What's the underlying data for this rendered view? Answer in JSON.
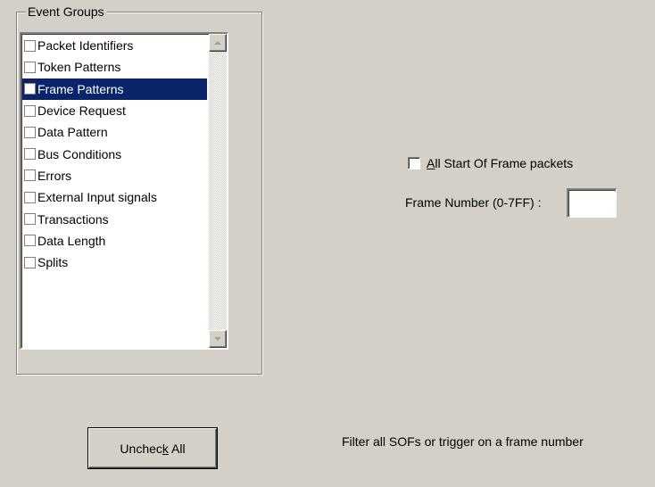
{
  "event_groups": {
    "title": "Event Groups",
    "items": [
      {
        "label": "Packet Identifiers",
        "checked": false,
        "selected": false
      },
      {
        "label": "Token Patterns",
        "checked": false,
        "selected": false
      },
      {
        "label": "Frame Patterns",
        "checked": false,
        "selected": true
      },
      {
        "label": "Device Request",
        "checked": false,
        "selected": false
      },
      {
        "label": "Data Pattern",
        "checked": false,
        "selected": false
      },
      {
        "label": "Bus Conditions",
        "checked": false,
        "selected": false
      },
      {
        "label": "Errors",
        "checked": false,
        "selected": false
      },
      {
        "label": "External Input signals",
        "checked": false,
        "selected": false
      },
      {
        "label": "Transactions",
        "checked": false,
        "selected": false
      },
      {
        "label": "Data Length",
        "checked": false,
        "selected": false
      },
      {
        "label": "Splits",
        "checked": false,
        "selected": false
      }
    ]
  },
  "frame_options": {
    "all_sof_checkbox": {
      "mnemonic": "A",
      "label_rest": "ll Start Of Frame packets",
      "checked": false
    },
    "frame_number_label": "Frame Number (0-7FF) :",
    "frame_number_value": ""
  },
  "uncheck_button": {
    "pre": "Unchec",
    "mnemonic": "k",
    "post": " All"
  },
  "hint_text": "Filter all SOFs or trigger on a frame number",
  "colors": {
    "background": "#d4d0c8",
    "selection": "#0a246a",
    "list_background": "#ffffff"
  }
}
